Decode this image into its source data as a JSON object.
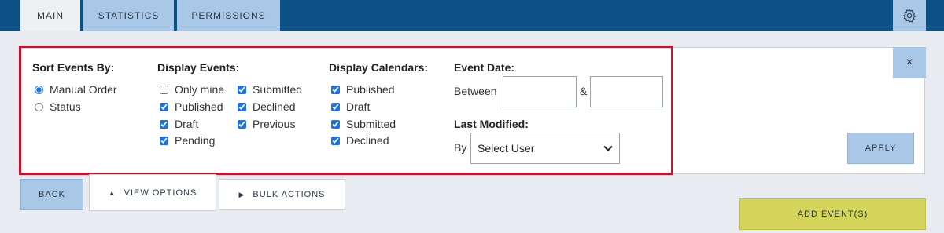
{
  "tabs": [
    {
      "label": "MAIN",
      "active": true
    },
    {
      "label": "STATISTICS",
      "active": false
    },
    {
      "label": "PERMISSIONS",
      "active": false
    }
  ],
  "settings_icon": "gear-icon",
  "close_label": "×",
  "sort": {
    "title": "Sort Events By:",
    "options": [
      {
        "label": "Manual Order",
        "checked": true
      },
      {
        "label": "Status",
        "checked": false
      }
    ]
  },
  "display_events": {
    "title": "Display Events:",
    "options": [
      {
        "label": "Only mine",
        "checked": false
      },
      {
        "label": "Published",
        "checked": true
      },
      {
        "label": "Draft",
        "checked": true
      },
      {
        "label": "Pending",
        "checked": true
      },
      {
        "label": "Submitted",
        "checked": true
      },
      {
        "label": "Declined",
        "checked": true
      },
      {
        "label": "Previous",
        "checked": true
      }
    ]
  },
  "display_calendars": {
    "title": "Display Calendars:",
    "options": [
      {
        "label": "Published",
        "checked": true
      },
      {
        "label": "Draft",
        "checked": true
      },
      {
        "label": "Submitted",
        "checked": true
      },
      {
        "label": "Declined",
        "checked": true
      }
    ]
  },
  "event_date": {
    "title": "Event Date:",
    "between_label": "Between",
    "and_label": "&",
    "from_value": "",
    "to_value": ""
  },
  "last_modified": {
    "title": "Last Modified:",
    "by_label": "By",
    "select_value": "Select User"
  },
  "buttons": {
    "apply": "APPLY",
    "back": "BACK",
    "view_options": "VIEW OPTIONS",
    "bulk_actions": "BULK ACTIONS",
    "add_events": "ADD EVENT(S)"
  },
  "colors": {
    "topbar": "#0e5186",
    "tab_inactive": "#a9c7e6",
    "highlight": "#c4122f",
    "add_button": "#d5d45a"
  }
}
